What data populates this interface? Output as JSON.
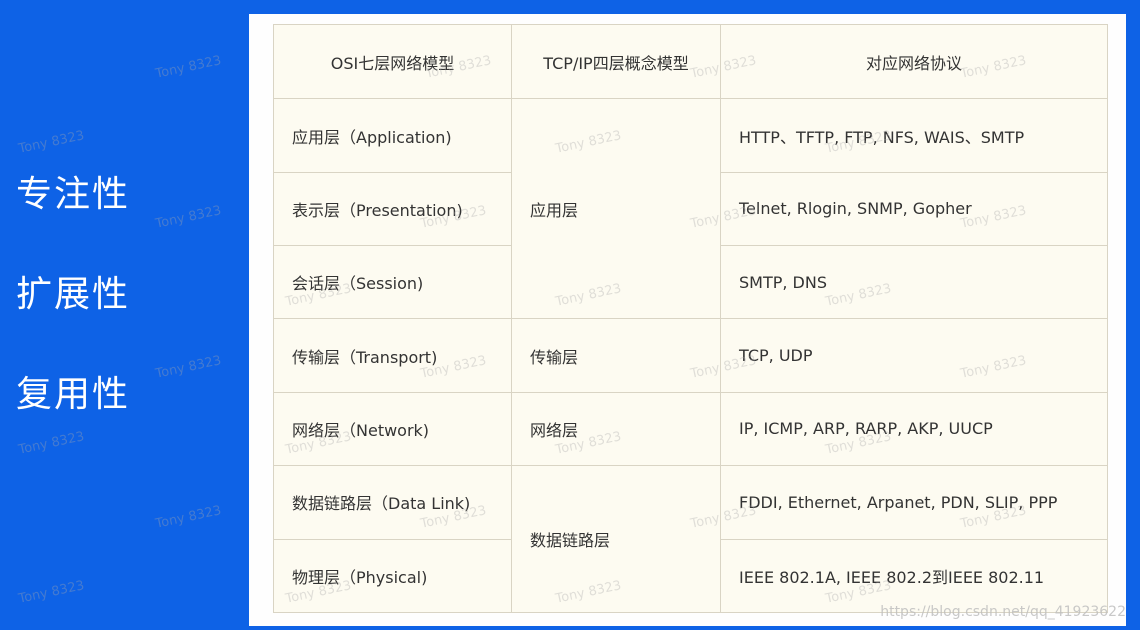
{
  "sidebar": {
    "items": [
      "专注性",
      "扩展性",
      "复用性"
    ]
  },
  "table": {
    "headers": [
      "OSI七层网络模型",
      "TCP/IP四层概念模型",
      "对应网络协议"
    ],
    "osi_layers": [
      "应用层（Application)",
      "表示层（Presentation)",
      "会话层（Session)",
      "传输层（Transport)",
      "网络层（Network)",
      "数据链路层（Data Link)",
      "物理层（Physical)"
    ],
    "tcpip_layers": [
      "应用层",
      "传输层",
      "网络层",
      "数据链路层"
    ],
    "protocols": [
      "HTTP、TFTP, FTP, NFS, WAIS、SMTP",
      "Telnet, Rlogin, SNMP, Gopher",
      "SMTP, DNS",
      "TCP, UDP",
      "IP, ICMP, ARP, RARP, AKP, UUCP",
      "FDDI, Ethernet, Arpanet, PDN, SLIP, PPP",
      "IEEE 802.1A, IEEE 802.2到IEEE 802.11"
    ]
  },
  "watermark_text": "Tony 8323",
  "source_url": "https://blog.csdn.net/qq_41923622"
}
